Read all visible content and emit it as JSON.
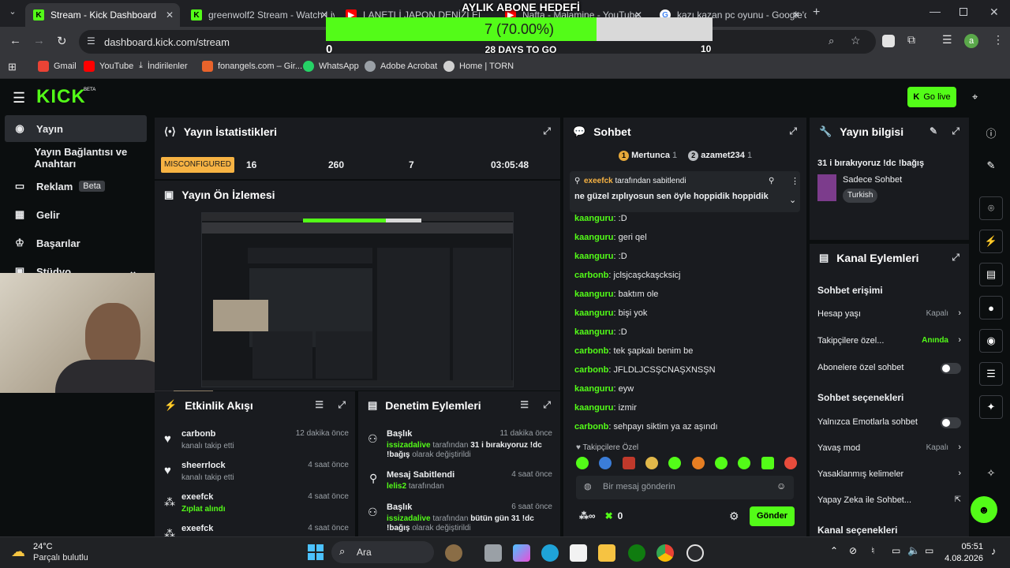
{
  "browser": {
    "tabs": [
      {
        "title": "Stream - Kick Dashboard",
        "active": true,
        "favicon": "kick-icon"
      },
      {
        "title": "greenwolf2 Stream - Watch Live",
        "active": false,
        "favicon": "kick-icon"
      },
      {
        "title": "LANETLİ JAPON DENİZLERİNE",
        "active": false,
        "favicon": "youtube-icon"
      },
      {
        "title": "Nafta - Malamine - YouTube",
        "active": false,
        "favicon": "youtube-icon"
      },
      {
        "title": "kazı kazan pc oyunu - Google'd",
        "active": false,
        "favicon": "google-icon"
      }
    ],
    "url": "dashboard.kick.com/stream",
    "profile_initial": "a",
    "bookmarks": [
      "Gmail",
      "YouTube",
      "İndirilenler",
      "fonangels.com – Gir...",
      "WhatsApp",
      "Adobe Acrobat",
      "Home | TORN"
    ]
  },
  "goal": {
    "title": "AYLIK ABONE HEDEFİ",
    "label": "7 (70.00%)",
    "progress": 0.7,
    "min": "0",
    "max": "10",
    "subtitle": "28 DAYS TO GO"
  },
  "app": {
    "beta_badge": "BETA",
    "go_live": "Go live",
    "sidebar": [
      {
        "label": "Yayın",
        "icon": "broadcast-icon",
        "active": true
      },
      {
        "label": "Yayın Bağlantısı ve Anahtarı",
        "icon": "",
        "active": false
      },
      {
        "label": "Reklam",
        "icon": "ad-icon",
        "badge": "Beta",
        "active": false
      },
      {
        "label": "Gelir",
        "icon": "chart-icon",
        "active": false
      },
      {
        "label": "Başarılar",
        "icon": "trophy-icon",
        "active": false
      },
      {
        "label": "Stüdyo",
        "icon": "studio-icon",
        "active": false
      }
    ],
    "stats": {
      "title": "Yayın İstatistikleri",
      "status": "MISCONFIGURED",
      "values": [
        "16",
        "260",
        "7",
        "03:05:48"
      ]
    },
    "preview": {
      "title": "Yayın Ön İzlemesi"
    },
    "activity": {
      "title": "Etkinlik Akışı",
      "items": [
        {
          "user": "carbonb",
          "desc": "kanalı takip etti",
          "time": "12 dakika önce",
          "icon": "heart-icon"
        },
        {
          "user": "sheerrlock",
          "desc": "kanalı takip etti",
          "time": "4 saat önce",
          "icon": "heart-icon"
        },
        {
          "user": "exeefck",
          "desc": "Zıplat alındı",
          "time": "4 saat önce",
          "icon": "points-icon"
        },
        {
          "user": "exeefck",
          "desc": "",
          "time": "4 saat önce",
          "icon": "points-icon"
        }
      ]
    },
    "moderation": {
      "title": "Denetim Eylemleri",
      "items": [
        {
          "action": "Başlık",
          "time": "11 dakika önce",
          "user": "issizadalive",
          "text1": "tarafından",
          "value": "31 i bırakıyoruz !dc !bağış",
          "text2": "olarak değiştirildi",
          "icon": "users-icon"
        },
        {
          "action": "Mesaj Sabitlendi",
          "time": "4 saat önce",
          "user": "lelis2",
          "text1": "tarafından",
          "value": "",
          "text2": "",
          "icon": "pin-icon"
        },
        {
          "action": "Başlık",
          "time": "6 saat önce",
          "user": "issizadalive",
          "text1": "tarafından",
          "value": "bütün gün 31 !dc !bağış",
          "text2": "olarak değiştirildi",
          "icon": "users-icon"
        }
      ]
    },
    "chat": {
      "title": "Sohbet",
      "top": [
        {
          "name": "Mertunca",
          "count": "1",
          "rank": "1"
        },
        {
          "name": "azamet234",
          "count": "1",
          "rank": "2"
        }
      ],
      "pinned_by_user": "exeefck",
      "pinned_by_text": "tarafından sabitlendi",
      "pinned_message": "ne güzel zıplıyosun sen öyle hoppidik hoppidik",
      "messages": [
        {
          "user": "kaanguru",
          "text": ":D"
        },
        {
          "user": "kaanguru",
          "text": "geri qel"
        },
        {
          "user": "kaanguru",
          "text": ":D"
        },
        {
          "user": "carbonb",
          "text": "jclsjcaşckaşcksicj"
        },
        {
          "user": "kaanguru",
          "text": "baktım ole"
        },
        {
          "user": "kaanguru",
          "text": "bişi yok"
        },
        {
          "user": "kaanguru",
          "text": ":D"
        },
        {
          "user": "carbonb",
          "text": "tek şapkalı benim be"
        },
        {
          "user": "carbonb",
          "text": "JFLDLJCSŞCNAŞXNSŞN"
        },
        {
          "user": "kaanguru",
          "text": "eyw"
        },
        {
          "user": "kaanguru",
          "text": "izmir"
        },
        {
          "user": "carbonb",
          "text": "sehpayı siktim ya az aşındı"
        }
      ],
      "emote_category": "Takipçilere Özel",
      "input_placeholder": "Bir mesaj gönderin",
      "points": "0",
      "send": "Gönder"
    },
    "stream_info": {
      "title": "Yayın bilgisi",
      "stream_title": "31 i bırakıyoruz !dc !bağış",
      "category": "Sadece Sohbet",
      "language": "Turkish"
    },
    "channel_actions": {
      "title": "Kanal Eylemleri",
      "section1": "Sohbet erişimi",
      "rows1": [
        {
          "label": "Hesap yaşı",
          "value": "Kapalı",
          "type": "select"
        },
        {
          "label": "Takipçilere özel...",
          "value": "Anında",
          "type": "select",
          "highlight": true
        },
        {
          "label": "Abonelere özel sohbet",
          "value": "",
          "type": "toggle"
        }
      ],
      "section2": "Sohbet seçenekleri",
      "rows2": [
        {
          "label": "Yalnızca Emotlarla sohbet",
          "value": "",
          "type": "toggle"
        },
        {
          "label": "Yavaş mod",
          "value": "Kapalı",
          "type": "select"
        },
        {
          "label": "Yasaklanmış kelimeler",
          "value": "",
          "type": "select"
        },
        {
          "label": "Yapay Zeka ile Sohbet...",
          "value": "",
          "type": "link"
        }
      ],
      "section3": "Kanal seçenekleri"
    }
  },
  "taskbar": {
    "weather_temp": "24°C",
    "weather_desc": "Parçalı bulutlu",
    "search": "Ara",
    "time": "05:51",
    "date": "4.08.2026"
  }
}
